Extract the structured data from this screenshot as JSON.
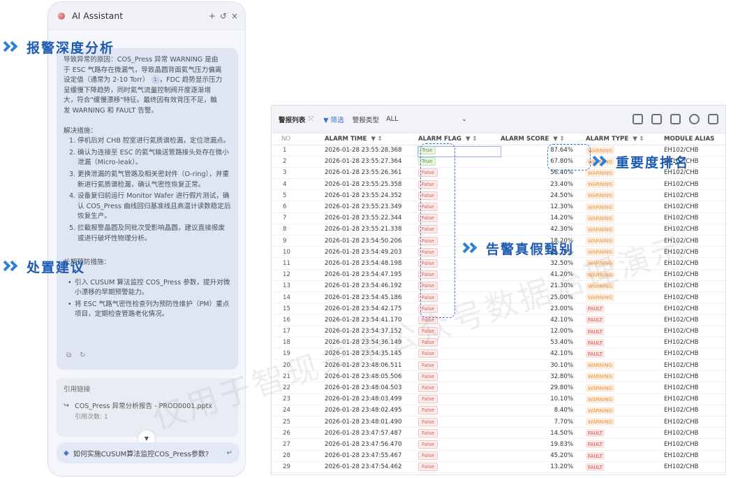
{
  "callouts": {
    "alarm_analysis": "报警深度分析",
    "handling_advice": "处置建议",
    "importance_rank": "重要度排名",
    "true_false_check": "告警真假甄别"
  },
  "watermark": "仅用于智现未来公众号数据治理演示",
  "ai": {
    "title": "AI Assistant",
    "icons": [
      "plus-icon",
      "history-icon",
      "close-icon"
    ],
    "cause_lines": [
      "导致异常的原因：COS_Press 异常 WARNING 是由",
      "于 ESC 气路存在微漏气，导致晶圆背面氦气压力偏离",
      "设定值（通常为 2-10 Torr）",
      "，FDC 趋势显示压力",
      "呈缓慢下降趋势，同时氦气流量控制阀开度逐渐增",
      "大，符合\"缓慢漂移\"特征。最终因有效背压不足，触",
      "发 WARNING 和 FAULT 告警。"
    ],
    "cite": "1",
    "solution_heading": "解决措施：",
    "solutions": [
      {
        "num": "1.",
        "text": "停机后对 CHB 腔室进行氦质谱检漏，定位泄漏点。"
      },
      {
        "num": "2.",
        "text": "确认为连接至 ESC 的氦气输送管路接头处存在微小泄漏（Micro-leak）。"
      },
      {
        "num": "3.",
        "text": "更换泄漏的氦气管路及相关密封件（O-ring），并重新进行氦质谱检漏，确认气密性恢复正常。"
      },
      {
        "num": "4.",
        "text": "设备复归前运行 Monitor Wafer 进行假片测试，确认 COS_Press 曲线回归基准线且高温计读数稳定后恢复生产。"
      },
      {
        "num": "5.",
        "text": "拦截报警晶圆及同批次受影响晶圆，建议直接报废或进行破坏性物理分析。"
      }
    ],
    "prevention_heading": "长期预防措施：",
    "preventions": [
      "引入 CUSUM 算法监控 COS_Press 参数，提升对微小漂移的早期预警能力。",
      "将 ESC 气路气密性检查列为预防性维护（PM）重点项目，定期检查管路老化情况。"
    ],
    "references": {
      "heading": "引用链接",
      "item_title": "COS_Press 异常分析报告 - PROD0001.pptx",
      "item_sub": "引用次数: 1"
    },
    "suggestion": "如何实施CUSUM算法监控COS_Press参数?"
  },
  "table": {
    "toolbar": {
      "title": "警报列表",
      "filter": "筛选",
      "type_label": "警报类型",
      "type_value": "ALL"
    },
    "columns": [
      "NO",
      "ALARM TIME",
      "ALARM FLAG",
      "ALARM SCORE",
      "ALARM TYPE",
      "MODULE ALIAS"
    ],
    "rows": [
      [
        "1",
        "2026-01-28 23:55:28.368",
        "True",
        "87.64%",
        "WARNING",
        "EH102/CHB"
      ],
      [
        "2",
        "2026-01-28 23:55:27.364",
        "True",
        "67.80%",
        "WARNING",
        "EH102/CHB"
      ],
      [
        "3",
        "2026-01-28 23:55:26.361",
        "False",
        "56.40%",
        "WARNING",
        "EH102/CHB"
      ],
      [
        "4",
        "2026-01-28 23:55:25.358",
        "False",
        "23.40%",
        "WARNING",
        "EH102/CHB"
      ],
      [
        "5",
        "2026-01-28 23:55:24.352",
        "False",
        "24.50%",
        "WARNING",
        "EH102/CHB"
      ],
      [
        "6",
        "2026-01-28 23:55:23.349",
        "False",
        "12.30%",
        "WARNING",
        "EH102/CHB"
      ],
      [
        "7",
        "2026-01-28 23:55:22.344",
        "False",
        "14.20%",
        "WARNING",
        "EH102/CHB"
      ],
      [
        "8",
        "2026-01-28 23:55:21.338",
        "False",
        "42.30%",
        "WARNING",
        "EH102/CHB"
      ],
      [
        "9",
        "2026-01-28 23:54:50.206",
        "False",
        "18.20%",
        "WARNING",
        "EH102/CHB"
      ],
      [
        "10",
        "2026-01-28 23:54:49.203",
        "False",
        "45.20%",
        "WARNING",
        "EH102/CHB"
      ],
      [
        "11",
        "2026-01-28 23:54:48.198",
        "False",
        "32.50%",
        "WARNING",
        "EH102/CHB"
      ],
      [
        "12",
        "2026-01-28 23:54:47.195",
        "False",
        "41.20%",
        "WARNING",
        "EH102/CHB"
      ],
      [
        "13",
        "2026-01-28 23:54:46.192",
        "False",
        "21.30%",
        "WARNING",
        "EH102/CHB"
      ],
      [
        "14",
        "2026-01-28 23:54:45.186",
        "False",
        "25.00%",
        "WARNING",
        "EH102/CHB"
      ],
      [
        "15",
        "2026-01-28 23:54:42.175",
        "False",
        "23.00%",
        "FAULT",
        "EH102/CHB"
      ],
      [
        "16",
        "2026-01-28 23:54:41.170",
        "False",
        "42.10%",
        "FAULT",
        "EH102/CHB"
      ],
      [
        "17",
        "2026-01-28 23:54:37.152",
        "False",
        "12.00%",
        "FAULT",
        "EH102/CHB"
      ],
      [
        "18",
        "2026-01-28 23:54:36.149",
        "False",
        "53.40%",
        "FAULT",
        "EH102/CHB"
      ],
      [
        "19",
        "2026-01-28 23:54:35.145",
        "False",
        "42.10%",
        "FAULT",
        "EH102/CHB"
      ],
      [
        "20",
        "2026-01-28 23:48:06.511",
        "False",
        "30.10%",
        "WARNING",
        "EH102/CHB"
      ],
      [
        "21",
        "2026-01-28 23:48:05.506",
        "False",
        "32.80%",
        "WARNING",
        "EH102/CHB"
      ],
      [
        "22",
        "2026-01-28 23:48:04.503",
        "False",
        "29.80%",
        "WARNING",
        "EH102/CHB"
      ],
      [
        "23",
        "2026-01-28 23:48:03.499",
        "False",
        "10.10%",
        "WARNING",
        "EH102/CHB"
      ],
      [
        "24",
        "2026-01-28 23:48:02.495",
        "False",
        "8.40%",
        "WARNING",
        "EH102/CHB"
      ],
      [
        "25",
        "2026-01-28 23:48:01.490",
        "False",
        "7.70%",
        "WARNING",
        "EH102/CHB"
      ],
      [
        "26",
        "2026-01-28 23:47:57.487",
        "False",
        "14.50%",
        "FAULT",
        "EH102/CHB"
      ],
      [
        "27",
        "2026-01-28 23:47:56.470",
        "False",
        "19.83%",
        "FAULT",
        "EH102/CHB"
      ],
      [
        "28",
        "2026-01-28 23:47:55.467",
        "False",
        "45.20%",
        "FAULT",
        "EH102/CHB"
      ],
      [
        "29",
        "2026-01-28 23:47:54.462",
        "False",
        "13.20%",
        "FAULT",
        "EH102/CHB"
      ]
    ]
  }
}
